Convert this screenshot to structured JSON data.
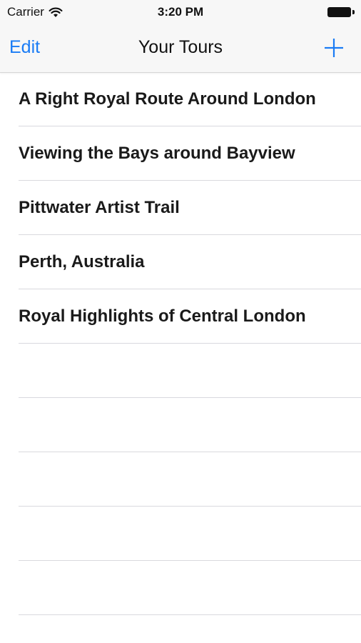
{
  "status_bar": {
    "carrier": "Carrier",
    "wifi_icon": "wifi-icon",
    "time": "3:20 PM",
    "battery_icon": "battery-icon"
  },
  "nav": {
    "edit_label": "Edit",
    "title": "Your Tours",
    "add_icon": "plus-icon",
    "accent_color": "#1a7cf5"
  },
  "tours": [
    {
      "label": "A Right Royal Route Around London"
    },
    {
      "label": "Viewing the Bays around Bayview"
    },
    {
      "label": "Pittwater Artist Trail"
    },
    {
      "label": "Perth, Australia"
    },
    {
      "label": "Royal Highlights of Central London"
    },
    {
      "label": ""
    },
    {
      "label": ""
    },
    {
      "label": ""
    },
    {
      "label": ""
    },
    {
      "label": ""
    }
  ]
}
